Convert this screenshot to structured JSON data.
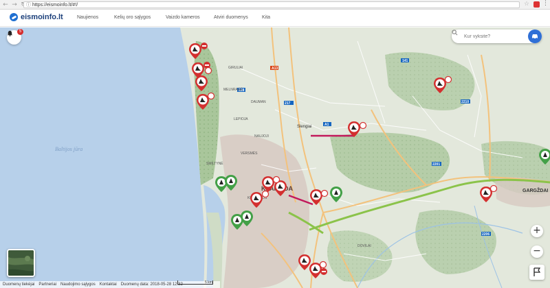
{
  "browser": {
    "url": "https://eismoinfo.lt/#!/",
    "back_icon": "back-arrow-icon",
    "forward_icon": "forward-arrow-icon",
    "reload_icon": "reload-icon"
  },
  "header": {
    "logo_text": "eismoinfo.lt",
    "nav": [
      "Naujienos",
      "Kelių oro sąlygos",
      "Vaizdo kameros",
      "Atviri duomenys",
      "Kita"
    ]
  },
  "notifications": {
    "count": "5"
  },
  "search": {
    "placeholder": "Kur vyksite?"
  },
  "zoom": {
    "in_label": "+",
    "out_label": "−"
  },
  "footer": {
    "links": [
      "Duomenų tiekėjai",
      "Partneriai",
      "Naudojimo sąlygos",
      "Kontaktai"
    ],
    "data_date": "Duomenų data: 2018-05-28 12:32",
    "scale_label": "5 km"
  },
  "map_labels": {
    "sea": "Baltijos jūra",
    "city_klaipeda": "KLAIPĖDA",
    "city_gargzdai": "GARGŽDAI",
    "town_slengiai": "Slengiai",
    "places": [
      "GIRULIAI",
      "MELNRAGĖ",
      "SMILTYNĖ",
      "LEPIOJA",
      "DAUMAN",
      "NAUJOJI",
      "VERSMĖS",
      "DOVILAI",
      "KLAIPĖDOS"
    ],
    "road_numbers": [
      "A13",
      "A1",
      "141",
      "217",
      "2201",
      "2206",
      "2210",
      "228"
    ]
  },
  "colors": {
    "sea": "#b7d0ea",
    "land": "#dfe6da",
    "forest": "#a9c69b",
    "urban": "#d7c9c2",
    "highway": "#8bc34a",
    "main_road": "#f3c27c",
    "closure": "#c2185b",
    "marker_red": "#d32f2f",
    "marker_green": "#43a047",
    "brand_blue": "#2f6fd6"
  }
}
